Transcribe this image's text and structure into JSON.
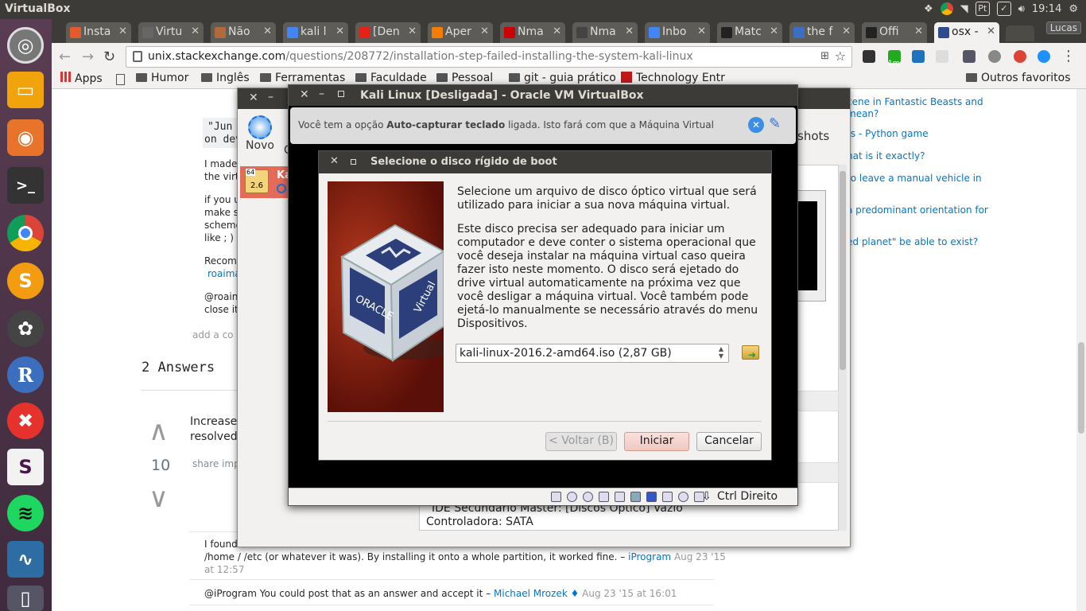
{
  "topbar": {
    "app_title": "VirtualBox",
    "keyboard_layout": "Pt",
    "clock": "19:14"
  },
  "browser": {
    "tabs": [
      {
        "label": "Insta",
        "fav_color": "#e35b2c"
      },
      {
        "label": "Virtu",
        "fav_color": "#666666"
      },
      {
        "label": "Não",
        "fav_color": "#b06a3c"
      },
      {
        "label": "kali l",
        "fav_color": "#4285f4"
      },
      {
        "label": "[Den",
        "fav_color": "#e62117"
      },
      {
        "label": "Aper",
        "fav_color": "#f57d00"
      },
      {
        "label": "Nma",
        "fav_color": "#cc0000"
      },
      {
        "label": "Nma",
        "fav_color": "#444444"
      },
      {
        "label": "Inbo",
        "fav_color": "#4285f4"
      },
      {
        "label": "Matc",
        "fav_color": "#222222"
      },
      {
        "label": "the f",
        "fav_color": "#3a6fc4"
      },
      {
        "label": "Offi",
        "fav_color": "#222222"
      },
      {
        "label": "osx -",
        "fav_color": "#2f4b8c"
      }
    ],
    "profile_name": "Lucas",
    "address": {
      "domain": "unix.stackexchange.com",
      "path": "/questions/208772/installation-step-failed-installing-the-system-kali-linux"
    },
    "bookmarks": [
      "Apps",
      "Humor",
      "Inglês",
      "Ferramentas",
      "Faculdade",
      "Pessoal",
      "git - guia prático",
      "Technology Entr"
    ],
    "other_bookmarks": "Outros favoritos",
    "extension_badge": "1m"
  },
  "page": {
    "code_line1": "\"Jun",
    "code_line2": "on dev",
    "lines": [
      "I made",
      "the virt",
      "if you u",
      "make s",
      "scheme",
      "like ; ) -",
      "Recom",
      "roaima",
      "@roain",
      "close it",
      "add a co"
    ],
    "answers_heading": "2 Answers",
    "answer_snippet1": "Increase",
    "answer_snippet2": "resolved",
    "vote_count": "10",
    "share_links": "share  imp",
    "comment1_a": "I found",
    "comment1_b": "/home / /etc (or whatever it was). By installing it onto a whole partition, it worked fine. –",
    "comment1_user": "iProgram",
    "comment1_time": "Aug 23 '15",
    "comment1_time2": "at 12:57",
    "comment2_a": "@iProgram You could post that as an answer and accept it –",
    "comment2_user": "Michael Mrozek ♦",
    "comment2_time": "Aug 23 '15 at 16:01",
    "hot_questions": [
      "cene in Fantastic Beasts and",
      "mean?",
      "rs - Python game",
      "hat is it exactly?",
      "to leave a manual vehicle in",
      "a predominant orientation for",
      "ed planet\" be able to exist?"
    ]
  },
  "vbox_manager": {
    "new_label": "Novo",
    "new_label2": "C",
    "snapshots_label": "shots",
    "vm_item_label": "Ka",
    "vm_badge": "2.6",
    "vm_arch": "64",
    "storage_line": "IDE Secundário Master:    [Discos Óptico] Vazio",
    "storage_controller": "Controladora: SATA"
  },
  "vm_window": {
    "title": "Kali Linux [Desligada] - Oracle VM VirtualBox",
    "notice_pre": "Você tem a opção ",
    "notice_bold": "Auto-capturar teclado",
    "notice_post": " ligada. Isto fará com que a Máquina Virtual",
    "host_key": "Ctrl Direito"
  },
  "dialog": {
    "title": "Selecione o disco rígido de boot",
    "para1": "Selecione um arquivo de disco óptico virtual que será utilizado para iniciar a sua nova máquina virtual.",
    "para2": "Este disco precisa ser adequado para iniciar um computador e deve conter o sistema operacional que você deseja instalar na máquina virtual caso queira fazer isto neste momento. O disco será ejetado do drive virtual automaticamente na próxima vez que você desligar a máquina virtual. Você também pode ejetá-lo manualmente se necessário através do menu Dispositivos.",
    "selected_disk": "kali-linux-2016.2-amd64.iso (2,87 GB)",
    "btn_back": "< Voltar (B)",
    "btn_start": "Iniciar",
    "btn_cancel": "Cancelar",
    "art_caption": "ORACLE",
    "art_caption2": "Virtual"
  }
}
